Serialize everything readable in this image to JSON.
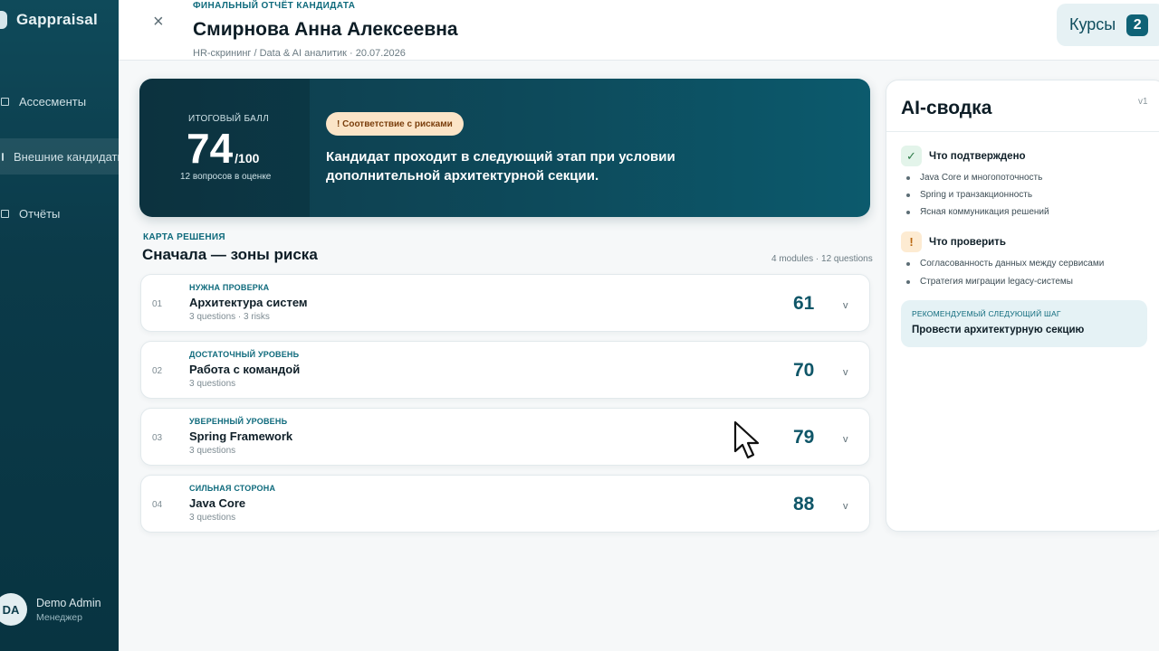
{
  "sidebar": {
    "brand": "Gappraisal",
    "items": [
      {
        "label": "Ассесменты",
        "active": false
      },
      {
        "label": "Внешние кандидаты",
        "active": true
      },
      {
        "label": "Отчёты",
        "active": false
      }
    ],
    "user": {
      "initials": "DA",
      "name": "Demo Admin",
      "role": "Менеджер"
    }
  },
  "header": {
    "eyebrow": "ФИНАЛЬНЫЙ ОТЧЁТ КАНДИДАТА",
    "title": "Смирнова Анна Алексеевна",
    "meta": "HR-скрининг / Data & AI аналитик · 20.07.2026",
    "close_icon": "×",
    "courses": {
      "label": "Курсы",
      "badge": "2"
    }
  },
  "hero": {
    "score_label": "ИТОГОВЫЙ БАЛЛ",
    "score": "74",
    "score_max": "/100",
    "score_sub": "12 вопросов в оценке",
    "risk_badge": "! Соответствие с рисками",
    "verdict": "Кандидат проходит в следующий этап при условии дополнительной архитектурной секции."
  },
  "decision_map": {
    "eyebrow": "КАРТА РЕШЕНИЯ",
    "title": "Сначала — зоны риска",
    "count": "4 modules · 12 questions",
    "modules": [
      {
        "num": "01",
        "status": "НУЖНА ПРОВЕРКА",
        "title": "Архитектура систем",
        "sub": "3 questions · 3 risks",
        "score": "61",
        "chevron": "v"
      },
      {
        "num": "02",
        "status": "ДОСТАТОЧНЫЙ УРОВЕНЬ",
        "title": "Работа с командой",
        "sub": "3 questions",
        "score": "70",
        "chevron": "v"
      },
      {
        "num": "03",
        "status": "УВЕРЕННЫЙ УРОВЕНЬ",
        "title": "Spring Framework",
        "sub": "3 questions",
        "score": "79",
        "chevron": "v"
      },
      {
        "num": "04",
        "status": "СИЛЬНАЯ СТОРОНА",
        "title": "Java Core",
        "sub": "3 questions",
        "score": "88",
        "chevron": "v"
      }
    ]
  },
  "ai_summary": {
    "title": "AI-сводка",
    "version": "v1",
    "confirmed": {
      "icon": "✓",
      "title": "Что подтверждено",
      "items": [
        "Java Core и многопоточность",
        "Spring и транзакционность",
        "Ясная коммуникация решений"
      ]
    },
    "to_check": {
      "icon": "!",
      "title": "Что проверить",
      "items": [
        "Согласованность данных между сервисами",
        "Стратегия миграции legacy-системы"
      ]
    },
    "next_step": {
      "label": "РЕКОМЕНДУЕМЫЙ СЛЕДУЮЩИЙ ШАГ",
      "text": "Провести архитектурную секцию"
    }
  },
  "colors": {
    "accent": "#0e6a7c",
    "sidebar": "#0b3a49",
    "risk_badge": "#fbe4c7"
  }
}
